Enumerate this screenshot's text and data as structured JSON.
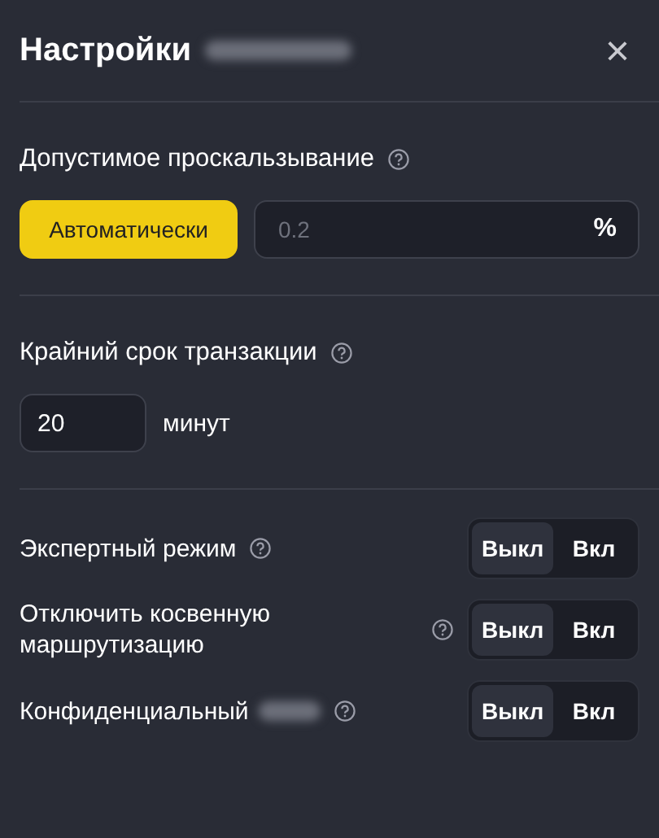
{
  "window": {
    "title": "Настройки",
    "close": "×"
  },
  "slippage": {
    "label": "Допустимое проскальзывание",
    "auto_button": {
      "label": "Автоматически",
      "selected": true
    },
    "input": {
      "placeholder": "0.2",
      "unit": "%"
    }
  },
  "deadline": {
    "label": "Крайний срок транзакции",
    "input": {
      "value": "20"
    },
    "unit": "минут"
  },
  "toggles": [
    {
      "label": "Экспертный режим",
      "options": [
        {
          "label": "Выкл",
          "selected": true
        },
        {
          "label": "Вкл",
          "selected": false
        }
      ]
    },
    {
      "label": "Отключить косвенную маршрутизацию",
      "options": [
        {
          "label": "Выкл",
          "selected": true
        },
        {
          "label": "Вкл",
          "selected": false
        }
      ]
    },
    {
      "label": "Конфиденциальный",
      "options": [
        {
          "label": "Выкл",
          "selected": true
        },
        {
          "label": "Вкл",
          "selected": false
        }
      ]
    }
  ]
}
